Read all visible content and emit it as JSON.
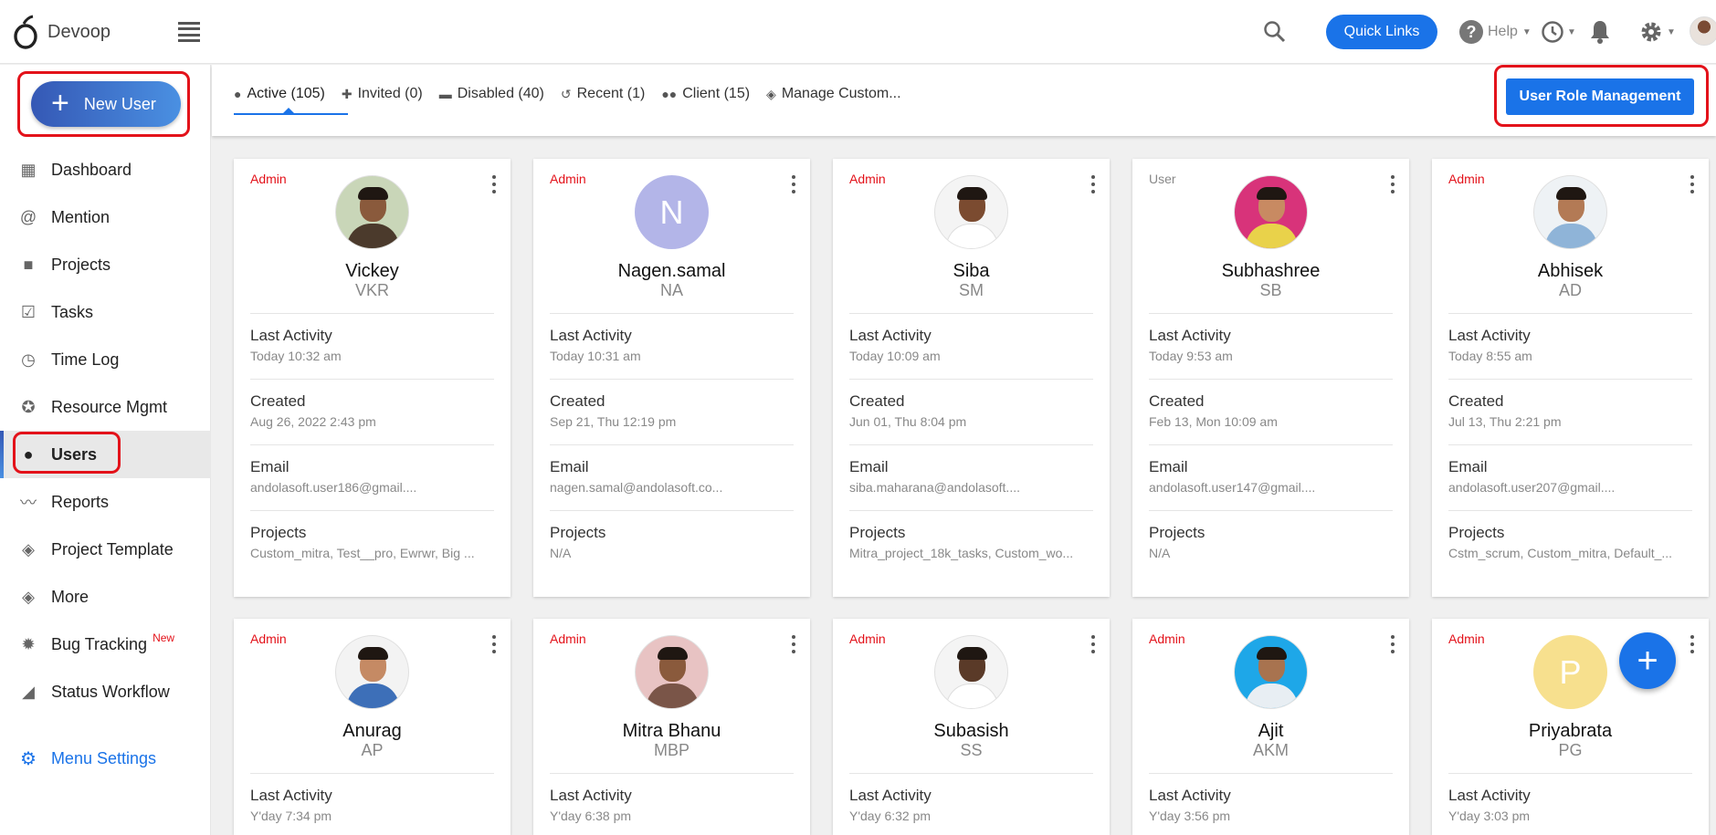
{
  "app": {
    "name": "Devoop"
  },
  "header": {
    "quick_links": "Quick Links",
    "help": "Help"
  },
  "sidebar": {
    "new_user": "New User",
    "items": [
      {
        "label": "Dashboard",
        "icon": "dashboard-icon"
      },
      {
        "label": "Mention",
        "icon": "at-icon"
      },
      {
        "label": "Projects",
        "icon": "briefcase-icon"
      },
      {
        "label": "Tasks",
        "icon": "clipboard-check-icon"
      },
      {
        "label": "Time Log",
        "icon": "clock-icon"
      },
      {
        "label": "Resource Mgmt",
        "icon": "resource-icon"
      },
      {
        "label": "Users",
        "icon": "person-icon",
        "active": true
      },
      {
        "label": "Reports",
        "icon": "trend-icon"
      },
      {
        "label": "Project Template",
        "icon": "layers-icon"
      },
      {
        "label": "More",
        "icon": "layers-icon"
      },
      {
        "label": "Bug Tracking",
        "icon": "bug-icon",
        "badge": "New"
      },
      {
        "label": "Status Workflow",
        "icon": "workflow-icon"
      }
    ],
    "menu_settings": "Menu Settings"
  },
  "tabs": [
    {
      "label": "Active (105)",
      "icon": "person-icon"
    },
    {
      "label": "Invited (0)",
      "icon": "person-add-icon"
    },
    {
      "label": "Disabled (40)",
      "icon": "minus-box-icon"
    },
    {
      "label": "Recent (1)",
      "icon": "history-icon"
    },
    {
      "label": "Client (15)",
      "icon": "people-icon"
    },
    {
      "label": "Manage Custom...",
      "icon": "layers-icon"
    }
  ],
  "role_button": "User Role Management",
  "labels": {
    "last_activity": "Last Activity",
    "created": "Created",
    "email": "Email",
    "projects": "Projects"
  },
  "users": [
    {
      "role": "Admin",
      "name": "Vickey",
      "initials": "VKR",
      "last_activity": "Today 10:32 am",
      "created": "Aug 26, 2022 2:43 pm",
      "email": "andolasoft.user186@gmail....",
      "projects": "Custom_mitra, Test__pro, Ewrwr, Big ..."
    },
    {
      "role": "Admin",
      "name": "Nagen.samal",
      "initials": "NA",
      "avatar_letter": "N",
      "avatar_color": "#b3b5e8",
      "last_activity": "Today 10:31 am",
      "created": "Sep 21, Thu 12:19 pm",
      "email": "nagen.samal@andolasoft.co...",
      "projects": "N/A"
    },
    {
      "role": "Admin",
      "name": "Siba",
      "initials": "SM",
      "last_activity": "Today 10:09 am",
      "created": "Jun 01, Thu 8:04 pm",
      "email": "siba.maharana@andolasoft....",
      "projects": "Mitra_project_18k_tasks, Custom_wo..."
    },
    {
      "role": "User",
      "name": "Subhashree",
      "initials": "SB",
      "last_activity": "Today 9:53 am",
      "created": "Feb 13, Mon 10:09 am",
      "email": "andolasoft.user147@gmail....",
      "projects": "N/A"
    },
    {
      "role": "Admin",
      "name": "Abhisek",
      "initials": "AD",
      "last_activity": "Today 8:55 am",
      "created": "Jul 13, Thu 2:21 pm",
      "email": "andolasoft.user207@gmail....",
      "projects": "Cstm_scrum, Custom_mitra, Default_..."
    },
    {
      "role": "Admin",
      "name": "Anurag",
      "initials": "AP",
      "last_activity": "Y'day 7:34 pm"
    },
    {
      "role": "Admin",
      "name": "Mitra Bhanu",
      "initials": "MBP",
      "last_activity": "Y'day 6:38 pm"
    },
    {
      "role": "Admin",
      "name": "Subasish",
      "initials": "SS",
      "last_activity": "Y'day 6:32 pm"
    },
    {
      "role": "Admin",
      "name": "Ajit",
      "initials": "AKM",
      "last_activity": "Y'day 3:56 pm"
    },
    {
      "role": "Admin",
      "name": "Priyabrata",
      "initials": "PG",
      "avatar_letter": "P",
      "avatar_color": "#f7e08e",
      "last_activity": "Y'day 3:03 pm"
    }
  ]
}
